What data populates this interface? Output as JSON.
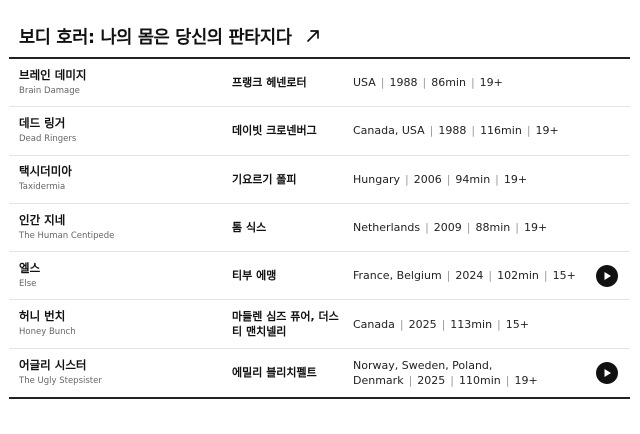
{
  "page": {
    "title": "보디 호러: 나의 몸은 당신의 판타지다"
  },
  "films": [
    {
      "title_ko": "브레인 데미지",
      "title_en": "Brain Damage",
      "director": "프랭크 헤넨로터",
      "meta": [
        "USA",
        "1988",
        "86min",
        "19+"
      ],
      "has_trailer": false
    },
    {
      "title_ko": "데드 링거",
      "title_en": "Dead Ringers",
      "director": "데이빗 크로넨버그",
      "meta": [
        "Canada, USA",
        "1988",
        "116min",
        "19+"
      ],
      "has_trailer": false
    },
    {
      "title_ko": "택시더미아",
      "title_en": "Taxidermia",
      "director": "기요르기 폴피",
      "meta": [
        "Hungary",
        "2006",
        "94min",
        "19+"
      ],
      "has_trailer": false
    },
    {
      "title_ko": "인간 지네",
      "title_en": "The Human Centipede",
      "director": "톰 식스",
      "meta": [
        "Netherlands",
        "2009",
        "88min",
        "19+"
      ],
      "has_trailer": false
    },
    {
      "title_ko": "엘스",
      "title_en": "Else",
      "director": "티부 에맹",
      "meta": [
        "France, Belgium",
        "2024",
        "102min",
        "15+"
      ],
      "has_trailer": true
    },
    {
      "title_ko": "허니 번치",
      "title_en": "Honey Bunch",
      "director": "마들렌 심즈 퓨어, 더스티 맨치넬리",
      "meta": [
        "Canada",
        "2025",
        "113min",
        "15+"
      ],
      "has_trailer": false
    },
    {
      "title_ko": "어글리 시스터",
      "title_en": "The Ugly Stepsister",
      "director": "에밀리 블리치펠트",
      "meta": [
        "Norway, Sweden, Poland, Denmark",
        "2025",
        "110min",
        "19+"
      ],
      "has_trailer": true
    }
  ],
  "icons": {
    "title_link": "arrow-up-right-icon",
    "trailer": "play-icon"
  },
  "colors": {
    "text": "#111111",
    "subtext": "#666666",
    "separator": "#9a9a9a",
    "button": "#111111",
    "divider": "#e4e4e4"
  }
}
